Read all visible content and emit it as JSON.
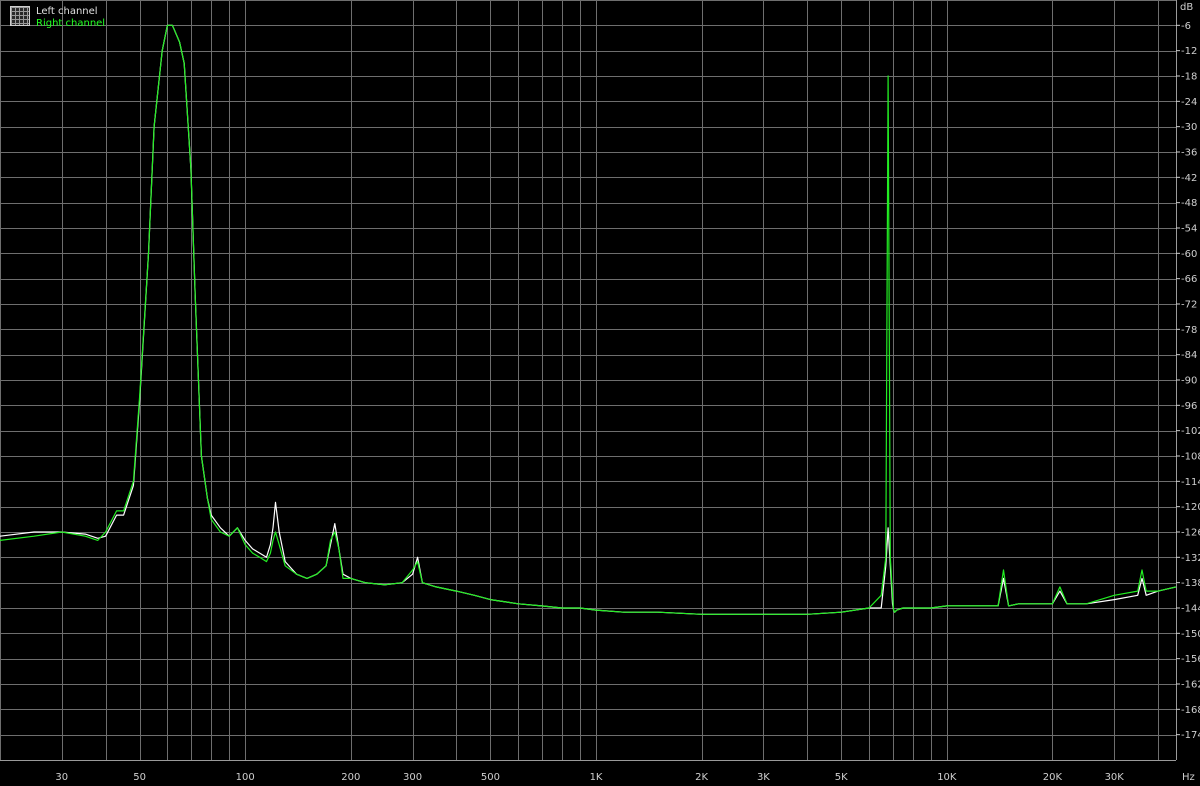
{
  "chart_data": {
    "type": "line",
    "title": "",
    "xlabel": "Hz",
    "ylabel": "dB",
    "x_scale": "log",
    "xlim": [
      20,
      45000
    ],
    "ylim": [
      -180,
      0
    ],
    "grid": true,
    "legend_placement": "top-left",
    "x_tick_labels": [
      {
        "value": 30,
        "label": "30"
      },
      {
        "value": 50,
        "label": "50"
      },
      {
        "value": 100,
        "label": "100"
      },
      {
        "value": 200,
        "label": "200"
      },
      {
        "value": 300,
        "label": "300"
      },
      {
        "value": 500,
        "label": "500"
      },
      {
        "value": 1000,
        "label": "1K"
      },
      {
        "value": 2000,
        "label": "2K"
      },
      {
        "value": 3000,
        "label": "3K"
      },
      {
        "value": 5000,
        "label": "5K"
      },
      {
        "value": 10000,
        "label": "10K"
      },
      {
        "value": 20000,
        "label": "20K"
      },
      {
        "value": 30000,
        "label": "30K"
      }
    ],
    "y_ticks": [
      -6,
      -12,
      -18,
      -24,
      -30,
      -36,
      -42,
      -48,
      -54,
      -60,
      -66,
      -72,
      -78,
      -84,
      -90,
      -96,
      -102,
      -108,
      -114,
      -120,
      -126,
      -132,
      -138,
      -144,
      -150,
      -156,
      -162,
      -168,
      -174
    ],
    "series": [
      {
        "name": "Left channel",
        "color": "#ffffff",
        "x": [
          20,
          25,
          30,
          35,
          38,
          40,
          43,
          45,
          48,
          50,
          53,
          55,
          58,
          60,
          62,
          65,
          67,
          70,
          72,
          75,
          78,
          80,
          85,
          90,
          95,
          100,
          105,
          110,
          115,
          118,
          120,
          122,
          125,
          130,
          140,
          150,
          160,
          170,
          175,
          180,
          185,
          190,
          200,
          220,
          250,
          280,
          300,
          310,
          320,
          350,
          400,
          450,
          500,
          600,
          700,
          800,
          900,
          1000,
          1200,
          1500,
          2000,
          2500,
          3000,
          4000,
          5000,
          6000,
          6500,
          6700,
          6800,
          6900,
          7000,
          7050,
          7100,
          7200,
          7500,
          8000,
          9000,
          10000,
          12000,
          14000,
          14500,
          15000,
          16000,
          18000,
          20000,
          21000,
          22000,
          25000,
          30000,
          35000,
          36000,
          37000,
          40000,
          45000
        ],
        "y": [
          -127,
          -126,
          -126,
          -126.5,
          -127.5,
          -127,
          -122,
          -122,
          -115,
          -95,
          -60,
          -30,
          -12,
          -6,
          -6,
          -10,
          -15,
          -40,
          -70,
          -108,
          -118,
          -122,
          -125,
          -127,
          -125,
          -128,
          -130,
          -131,
          -132,
          -129,
          -125,
          -119,
          -126,
          -133,
          -136,
          -137,
          -136,
          -134,
          -129,
          -124,
          -130,
          -136,
          -137,
          -138,
          -138.5,
          -138,
          -136,
          -132,
          -138,
          -139,
          -140,
          -141,
          -142,
          -143,
          -143.5,
          -144,
          -144,
          -144.5,
          -145,
          -145,
          -145.5,
          -145.5,
          -145.5,
          -145.5,
          -145,
          -144,
          -144,
          -134,
          -125,
          -134,
          -143,
          -144.5,
          -145,
          -144.5,
          -144,
          -144,
          -144,
          -143.5,
          -143.5,
          -143.5,
          -137,
          -143.5,
          -143,
          -143,
          -143,
          -140,
          -143,
          -143,
          -142,
          -141,
          -137,
          -141,
          -140,
          -139
        ]
      },
      {
        "name": "Right channel",
        "color": "#22ee22",
        "x": [
          20,
          25,
          30,
          35,
          38,
          40,
          43,
          45,
          48,
          50,
          53,
          55,
          58,
          60,
          62,
          65,
          67,
          70,
          72,
          75,
          78,
          80,
          85,
          90,
          95,
          100,
          105,
          110,
          115,
          118,
          120,
          122,
          125,
          130,
          140,
          150,
          160,
          170,
          175,
          180,
          185,
          190,
          200,
          220,
          250,
          280,
          300,
          310,
          320,
          350,
          400,
          450,
          500,
          600,
          700,
          800,
          900,
          1000,
          1200,
          1500,
          2000,
          2500,
          3000,
          4000,
          5000,
          6000,
          6500,
          6700,
          6800,
          6900,
          7000,
          7050,
          7100,
          7200,
          7500,
          8000,
          9000,
          10000,
          12000,
          14000,
          14500,
          15000,
          16000,
          18000,
          20000,
          21000,
          22000,
          25000,
          30000,
          35000,
          36000,
          37000,
          40000,
          45000
        ],
        "y": [
          -128,
          -127,
          -126,
          -127,
          -128,
          -126,
          -121,
          -121,
          -114,
          -94,
          -60,
          -30,
          -12,
          -6,
          -6,
          -10,
          -15,
          -40,
          -70,
          -108,
          -118,
          -123,
          -126,
          -127,
          -125,
          -129,
          -131,
          -132,
          -133,
          -131,
          -128,
          -126,
          -129,
          -134,
          -136,
          -137,
          -136,
          -134,
          -128,
          -126,
          -130,
          -137,
          -137,
          -138,
          -138.5,
          -138,
          -135,
          -133,
          -138,
          -139,
          -140,
          -141,
          -142,
          -143,
          -143.5,
          -144,
          -144,
          -144.5,
          -145,
          -145,
          -145.5,
          -145.5,
          -145.5,
          -145.5,
          -145,
          -144,
          -141,
          -132,
          -18,
          -132,
          -141,
          -144.5,
          -145,
          -144.5,
          -144,
          -144,
          -144,
          -143.5,
          -143.5,
          -143.5,
          -135,
          -143.5,
          -143,
          -143,
          -143,
          -139,
          -143,
          -143,
          -141,
          -140,
          -135,
          -140,
          -140,
          -139
        ]
      }
    ]
  }
}
